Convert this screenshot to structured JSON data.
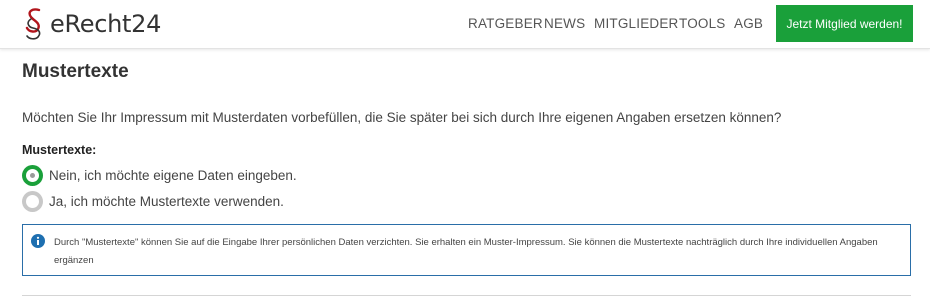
{
  "header": {
    "logo_text": "eRecht24",
    "nav": [
      {
        "label": "RATGEBER"
      },
      {
        "label": "NEWS"
      },
      {
        "label": "MITGLIEDER"
      },
      {
        "label": "TOOLS"
      },
      {
        "label": "AGB"
      }
    ],
    "cta_label": "Jetzt Mitglied werden!"
  },
  "main": {
    "title": "Mustertexte",
    "question": "Möchten Sie Ihr Impressum mit Musterdaten vorbefüllen, die Sie später bei sich durch Ihre eigenen Angaben ersetzen können?",
    "field_label": "Mustertexte:",
    "options": [
      {
        "label": "Nein, ich möchte eigene Daten eingeben.",
        "checked": true
      },
      {
        "label": "Ja, ich möchte Mustertexte verwenden.",
        "checked": false
      }
    ],
    "info": {
      "icon": "info-circle-icon",
      "text": "Durch \"Mustertexte\" können Sie auf die Eingabe Ihrer persönlichen Daten verzichten. Sie erhalten ein Muster-Impressum. Sie können die Mustertexte nachträglich durch Ihre individuellen Angaben ergänzen"
    }
  },
  "colors": {
    "accent_green": "#1aa03a",
    "info_border": "#2a6ea8",
    "text": "#333333"
  }
}
